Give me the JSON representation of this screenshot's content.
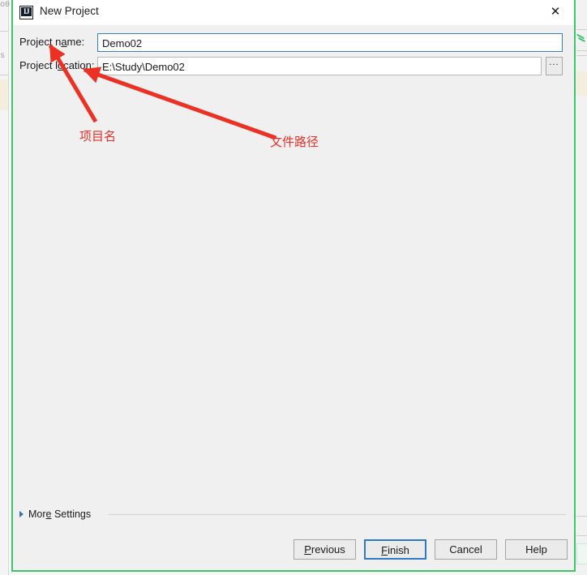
{
  "window": {
    "title": "New Project",
    "icon": "intellij-idea-icon",
    "icon_glyph": "IJ",
    "close_label": "✕"
  },
  "form": {
    "project_name": {
      "label_pre": "Project n",
      "label_mnemonic": "a",
      "label_post": "me:",
      "label_full": "Project name:",
      "value": "Demo02",
      "placeholder": ""
    },
    "project_location": {
      "label_pre": "Project l",
      "label_mnemonic": "o",
      "label_post": "cation:",
      "label_full": "Project location:",
      "value": "E:\\Study\\Demo02",
      "placeholder": "",
      "browse_label": "..."
    }
  },
  "annotations": [
    {
      "text": "项目名",
      "meaning": "project-name-annotation",
      "color": "#e8312a"
    },
    {
      "text": "文件路径",
      "meaning": "file-path-annotation",
      "color": "#e8312a"
    }
  ],
  "footer": {
    "more_settings": {
      "pre": "Mor",
      "mnemonic": "e",
      "post": " Settings",
      "full": "More Settings",
      "expanded": false
    },
    "buttons": [
      {
        "pre": "",
        "mnemonic": "P",
        "post": "revious",
        "full": "Previous",
        "default": false
      },
      {
        "pre": "",
        "mnemonic": "F",
        "post": "inish",
        "full": "Finish",
        "default": true
      },
      {
        "pre": "Cancel",
        "mnemonic": "",
        "post": "",
        "full": "Cancel",
        "default": false
      },
      {
        "pre": "Help",
        "mnemonic": "",
        "post": "",
        "full": "Help",
        "default": false
      }
    ]
  },
  "colors": {
    "dialog_border": "#3ec46d",
    "dialog_background": "#f0f0f0",
    "focus_border": "#3b7fc4",
    "default_button_border": "#2f79c4",
    "annotation_red": "#e8312a"
  }
}
